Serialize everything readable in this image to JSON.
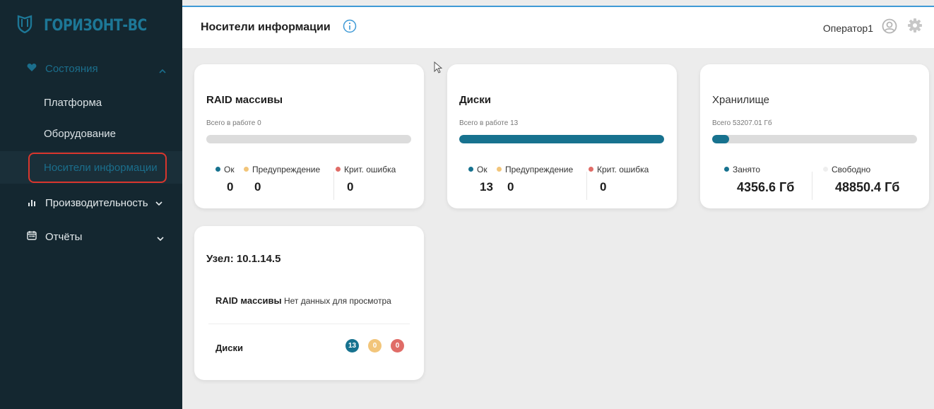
{
  "sidebar": {
    "logo_text": "ГОРИЗОНТ-ВС",
    "states_label": "Состояния",
    "items": [
      {
        "label": "Платформа"
      },
      {
        "label": "Оборудование"
      },
      {
        "label": "Носители информации"
      }
    ],
    "performance_label": "Производительность",
    "reports_label": "Отчёты"
  },
  "header": {
    "title": "Носители информации",
    "operator": "Оператор1"
  },
  "raid_card": {
    "title": "RAID массивы",
    "subtitle": "Всего в работе 0",
    "progress": 0,
    "legend": {
      "ok": "Ок",
      "warn": "Предупреждение",
      "crit": "Крит. ошибка"
    },
    "counts": {
      "ok": "0",
      "warn": "0",
      "crit": "0"
    }
  },
  "disks_card": {
    "title": "Диски",
    "subtitle": "Всего в работе 13",
    "progress": 1.0,
    "legend": {
      "ok": "Ок",
      "warn": "Предупреждение",
      "crit": "Крит. ошибка"
    },
    "counts": {
      "ok": "13",
      "warn": "0",
      "crit": "0"
    }
  },
  "storage_card": {
    "title": "Хранилище",
    "subtitle": "Всего 53207.01 Гб",
    "progress": 0.082,
    "used_label": "Занято",
    "free_label": "Свободно",
    "used_value": "4356.6 Гб",
    "free_value": "48850.4 Гб"
  },
  "node_card": {
    "title": "Узел: 10.1.14.5",
    "raid_label": "RAID массивы",
    "raid_value": "Нет данных для просмотра",
    "disks_label": "Диски",
    "badges": {
      "ok": "13",
      "warn": "0",
      "crit": "0"
    }
  },
  "colors": {
    "sidebar_bg": "#142730",
    "accent": "#17728f",
    "warning": "#f2c57a",
    "critical": "#e06c67",
    "active_outline": "#d9362d"
  }
}
